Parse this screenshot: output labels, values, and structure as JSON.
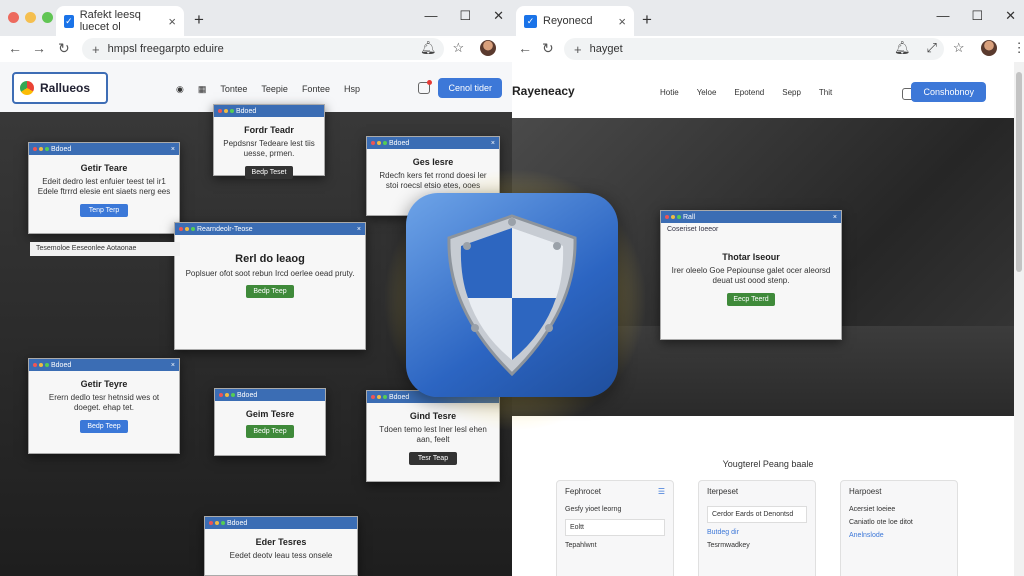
{
  "left_window": {
    "tab_title": "Rafekt leesq luecet ol",
    "url": "hmpsl freegarpto eduire",
    "site_logo": "Rallueos",
    "nav": [
      "Tontee",
      "Teepie",
      "Fontee",
      "Hsp"
    ],
    "cta": "Cenol tider",
    "popups": [
      {
        "bar": "Bdoed",
        "title": "Fordr Teadr",
        "body": "Pepdsnsr Tedeare lest tiis uesse, prmen.",
        "btn": "Bedp Teset"
      },
      {
        "bar": "Bdoed",
        "title": "Getir Teare",
        "body": "Edeit dedro lest enfuier teest tel ir1 Edele ftrrrd elesie ent siaets nerg ees",
        "btn": "Tenp Terp"
      },
      {
        "bar": "Bdoed",
        "title": "Ges Iesre",
        "body": "Rdecfn kers fet rrond doesi ler stoi roecsl etsio etes, ooes",
        "btn": ""
      },
      {
        "bar": "Rearndeolr-Teose",
        "title": "Rerl do leaog",
        "body": "Poplsuer ofot soot rebun Ircd oerlee oead pruty.",
        "btn": "Bedp Teep"
      },
      {
        "bar": "Bdoed",
        "title": "Getir Teyre",
        "body": "Erern dedlo tesr hetnsid wes ot doeget. ehap tet.",
        "btn": "Bedp Teep"
      },
      {
        "bar": "Bdoed",
        "title": "Geim Tesre",
        "body": "",
        "btn": "Bedp Teep"
      },
      {
        "bar": "Bdoed",
        "title": "Gind Tesre",
        "body": "Tdoen temo lest Iner lesl ehen aan, feelt",
        "btn": "Tesr Teap"
      },
      {
        "bar": "Bdoed",
        "title": "Eder Tesres",
        "body": "Eedet deotv leau tess onsele",
        "btn": ""
      }
    ],
    "status_text": "Tesemoloe Eeseonlee  Aotaonae"
  },
  "right_window": {
    "tab_title": "Reyonecd",
    "url": "hayget",
    "site_logo": "Rayeneacy",
    "nav": [
      "Hotie",
      "Yeloe",
      "Epotend",
      "Sepp",
      "Thit"
    ],
    "cta": "Conshobnoy",
    "popup": {
      "bar": "Rall",
      "sub": "Coseriset Ioeeor",
      "title": "Thotar Iseour",
      "body": "Irer oleelo Goe Pepiounse galet ocer aleorsd deuat ust oood stenp.",
      "btn": "Eecp Teerd"
    },
    "section_title": "Yougterel Peang baale",
    "cards": [
      {
        "head": "Fephrocet",
        "line1": "Gesfy yioet leorng",
        "line2": "Eoltt",
        "line3": "Tepahlwnt"
      },
      {
        "head": "Iterpeset",
        "line1": "Cerdor Eards ot Denontsd",
        "line2": "Butdeg dir",
        "line3": "Tesrmwadkey"
      },
      {
        "head": "Harpoest",
        "line1": "Acersiet Ioeiee",
        "line2": "Caniatlo ote loe ditot",
        "line3": "Anelnslode"
      }
    ]
  },
  "colors": {
    "accent": "#3d78d8",
    "title_bar": "#3b6db4",
    "green": "#3f8a3a"
  }
}
